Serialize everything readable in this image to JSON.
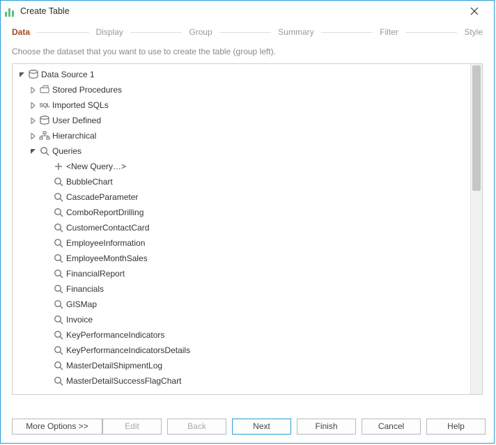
{
  "window": {
    "title": "Create Table"
  },
  "wizard": {
    "steps": {
      "data": "Data",
      "display": "Display",
      "group": "Group",
      "summary": "Summary",
      "filter": "Filter",
      "style": "Style"
    },
    "subtitle": "Choose the dataset that you want to use to create the table (group left)."
  },
  "tree": {
    "root": {
      "label": "Data Source 1"
    },
    "categories": {
      "stored_procedures": "Stored Procedures",
      "imported_sqls": "Imported SQLs",
      "user_defined": "User Defined",
      "hierarchical": "Hierarchical",
      "queries": "Queries"
    },
    "queries": [
      "<New Query…>",
      "BubbleChart",
      "CascadeParameter",
      "ComboReportDrilling",
      "CustomerContactCard",
      "EmployeeInformation",
      "EmployeeMonthSales",
      "FinancialReport",
      "Financials",
      "GISMap",
      "Invoice",
      "KeyPerformanceIndicators",
      "KeyPerformanceIndicatorsDetails",
      "MasterDetailShipmentLog",
      "MasterDetailSuccessFlagChart"
    ]
  },
  "footer": {
    "more_options": "More Options >>",
    "edit": "Edit",
    "back": "Back",
    "next": "Next",
    "finish": "Finish",
    "cancel": "Cancel",
    "help": "Help"
  }
}
